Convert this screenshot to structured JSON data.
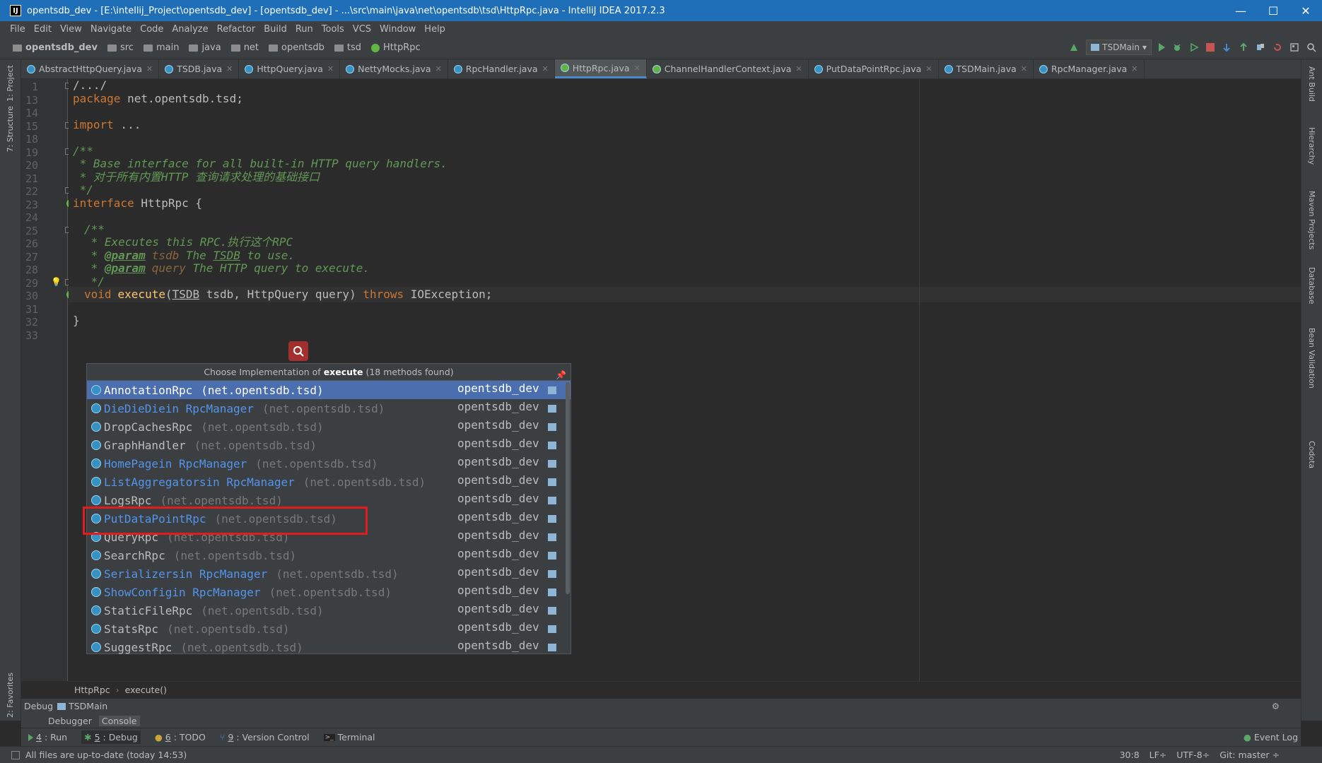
{
  "window": {
    "title": "opentsdb_dev - [E:\\intellij_Project\\opentsdb_dev] - [opentsdb_dev] - ...\\src\\main\\java\\net\\opentsdb\\tsd\\HttpRpc.java - IntelliJ IDEA 2017.2.3",
    "app_icon": "IJ",
    "minimize": "—",
    "maximize": "☐",
    "close": "✕"
  },
  "menu": [
    "File",
    "Edit",
    "View",
    "Navigate",
    "Code",
    "Analyze",
    "Refactor",
    "Build",
    "Run",
    "Tools",
    "VCS",
    "Window",
    "Help"
  ],
  "breadcrumbs": [
    "opentsdb_dev",
    "src",
    "main",
    "java",
    "net",
    "opentsdb",
    "tsd",
    "HttpRpc"
  ],
  "run_config": "TSDMain",
  "tabs": [
    {
      "label": "AbstractHttpQuery.java",
      "type": "class"
    },
    {
      "label": "TSDB.java",
      "type": "class"
    },
    {
      "label": "HttpQuery.java",
      "type": "class"
    },
    {
      "label": "NettyMocks.java",
      "type": "class"
    },
    {
      "label": "RpcHandler.java",
      "type": "class"
    },
    {
      "label": "HttpRpc.java",
      "type": "interface",
      "active": true
    },
    {
      "label": "ChannelHandlerContext.java",
      "type": "interface"
    },
    {
      "label": "PutDataPointRpc.java",
      "type": "class"
    },
    {
      "label": "TSDMain.java",
      "type": "class"
    },
    {
      "label": "RpcManager.java",
      "type": "class"
    }
  ],
  "left_tools": [
    "1: Project",
    "7: Structure",
    "2: Favorites"
  ],
  "right_tools": [
    "Ant Build",
    "Hierarchy",
    "Maven Projects",
    "Database",
    "Bean Validation",
    "Codota"
  ],
  "code": {
    "line_numbers": [
      "1",
      "13",
      "14",
      "15",
      "18",
      "19",
      "20",
      "21",
      "22",
      "23",
      "24",
      "25",
      "26",
      "27",
      "28",
      "29",
      "30",
      "31",
      "32",
      "33"
    ],
    "l1": "/.../",
    "l13_kw": "package",
    "l13_rest": " net.opentsdb.tsd;",
    "l15_kw": "import",
    "l15_rest": " ...",
    "l19": "/**",
    "l20": " * Base interface for all built-in HTTP query handlers.",
    "l21": " * 对于所有内置HTTP 查询请求处理的基础接口",
    "l22": " */",
    "l23_kw": "interface",
    "l23_rest": " HttpRpc {",
    "l25": "/**",
    "l26": " * Executes this RPC.执行这个RPC",
    "l27_star": " * ",
    "l27_tag": "@param",
    "l27_p": "tsdb",
    "l27_a": " The ",
    "l27_b": "TSDB",
    "l27_c": " to use.",
    "l28_star": " * ",
    "l28_tag": "@param",
    "l28_p": "query",
    "l28_c": " The HTTP query to execute.",
    "l29": " */",
    "l30_void": "void",
    "l30_fn": "execute",
    "l30_a": "(",
    "l30_t": "TSDB",
    "l30_b": " tsdb, HttpQuery query) ",
    "l30_throws": "throws",
    "l30_c": " IOException;",
    "l32": "}"
  },
  "popup": {
    "prefix": "Choose Implementation of ",
    "method": "execute",
    "suffix": " (18 methods found)",
    "items": [
      {
        "name": "AnnotationRpc",
        "inner": "",
        "pkg": "(net.opentsdb.tsd)",
        "module": "opentsdb_dev",
        "selected": true
      },
      {
        "name": "DieDieDie",
        "inner": " in RpcManager",
        "pkg": "(net.opentsdb.tsd)",
        "module": "opentsdb_dev"
      },
      {
        "name": "DropCachesRpc",
        "inner": "",
        "pkg": "(net.opentsdb.tsd)",
        "module": "opentsdb_dev"
      },
      {
        "name": "GraphHandler",
        "inner": "",
        "pkg": "(net.opentsdb.tsd)",
        "module": "opentsdb_dev"
      },
      {
        "name": "HomePage",
        "inner": " in RpcManager",
        "pkg": "(net.opentsdb.tsd)",
        "module": "opentsdb_dev"
      },
      {
        "name": "ListAggregators",
        "inner": " in RpcManager",
        "pkg": "(net.opentsdb.tsd)",
        "module": "opentsdb_dev"
      },
      {
        "name": "LogsRpc",
        "inner": "",
        "pkg": "(net.opentsdb.tsd)",
        "module": "opentsdb_dev"
      },
      {
        "name": "PutDataPointRpc",
        "inner": "",
        "pkg": "(net.opentsdb.tsd)",
        "module": "opentsdb_dev"
      },
      {
        "name": "QueryRpc",
        "inner": "",
        "pkg": "(net.opentsdb.tsd)",
        "module": "opentsdb_dev"
      },
      {
        "name": "SearchRpc",
        "inner": "",
        "pkg": "(net.opentsdb.tsd)",
        "module": "opentsdb_dev"
      },
      {
        "name": "Serializers",
        "inner": " in RpcManager",
        "pkg": "(net.opentsdb.tsd)",
        "module": "opentsdb_dev"
      },
      {
        "name": "ShowConfig",
        "inner": " in RpcManager",
        "pkg": "(net.opentsdb.tsd)",
        "module": "opentsdb_dev"
      },
      {
        "name": "StaticFileRpc",
        "inner": "",
        "pkg": "(net.opentsdb.tsd)",
        "module": "opentsdb_dev"
      },
      {
        "name": "StatsRpc",
        "inner": "",
        "pkg": "(net.opentsdb.tsd)",
        "module": "opentsdb_dev"
      },
      {
        "name": "SuggestRpc",
        "inner": "",
        "pkg": "(net.opentsdb.tsd)",
        "module": "opentsdb_dev"
      }
    ]
  },
  "editor_breadcrumb": [
    "HttpRpc",
    "execute()"
  ],
  "debug": {
    "label": "Debug",
    "config": "TSDMain",
    "tabs": [
      "Debugger",
      "Console"
    ]
  },
  "tool_windows": [
    {
      "num": "4",
      "label": ": Run"
    },
    {
      "num": "5",
      "label": ": Debug",
      "active": true
    },
    {
      "num": "6",
      "label": ": TODO"
    },
    {
      "num": "9",
      "label": ": Version Control"
    },
    {
      "num": "",
      "label": "Terminal"
    }
  ],
  "event_log": "Event Log",
  "status": {
    "message": "All files are up-to-date (today 14:53)",
    "position": "30:8",
    "line_sep": "LF÷",
    "encoding": "UTF-8÷",
    "vcs": "Git: master ÷"
  },
  "colors": {
    "accent": "#4b6eaf",
    "highlight_box": "#e21c1c",
    "title_bar": "#1f6fb8"
  }
}
